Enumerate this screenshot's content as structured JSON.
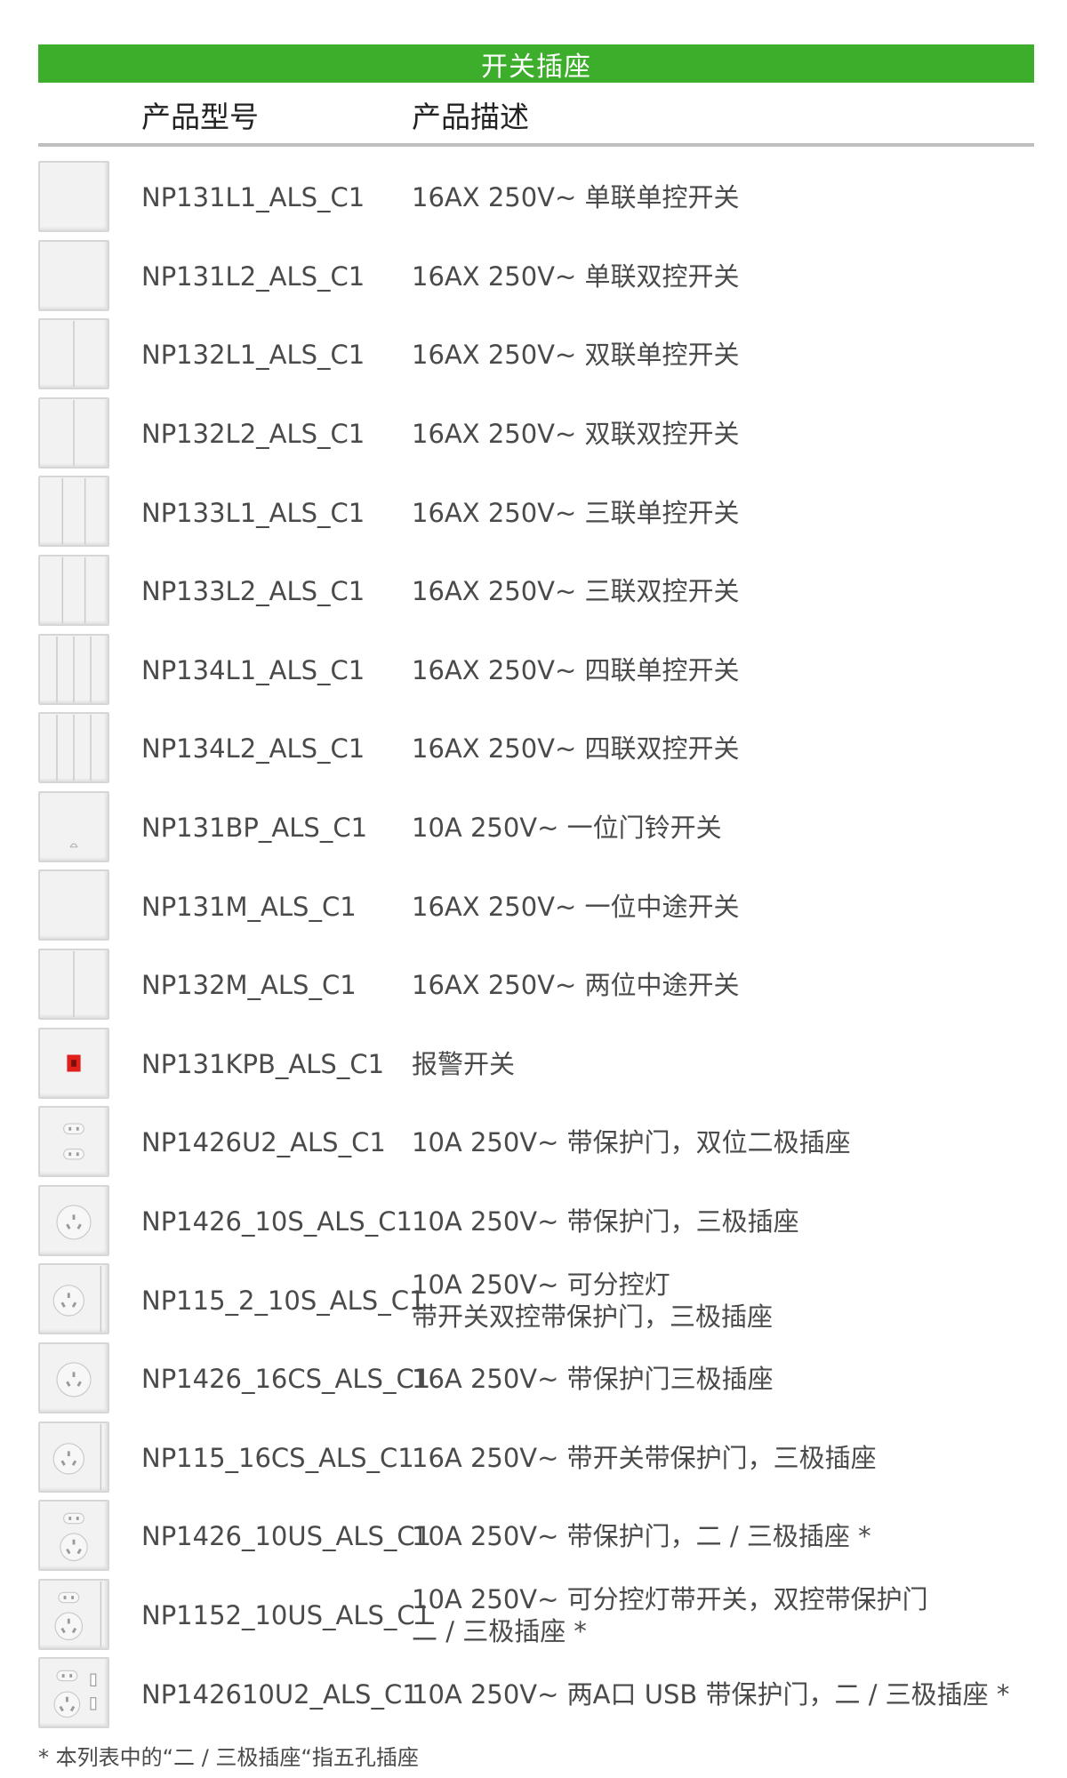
{
  "banner": {
    "title": "开关插座"
  },
  "header": {
    "model_label": "产品型号",
    "desc_label": "产品描述"
  },
  "rows": [
    {
      "model": "NP131L1_ALS_C1",
      "desc": [
        "16AX 250V~ 单联单控开关"
      ],
      "icon": "switch-1gang-icon"
    },
    {
      "model": "NP131L2_ALS_C1",
      "desc": [
        "16AX 250V~ 单联双控开关"
      ],
      "icon": "switch-1gang-icon"
    },
    {
      "model": "NP132L1_ALS_C1",
      "desc": [
        "16AX 250V~ 双联单控开关"
      ],
      "icon": "switch-2gang-icon"
    },
    {
      "model": "NP132L2_ALS_C1",
      "desc": [
        "16AX 250V~ 双联双控开关"
      ],
      "icon": "switch-2gang-icon"
    },
    {
      "model": "NP133L1_ALS_C1",
      "desc": [
        "16AX 250V~ 三联单控开关"
      ],
      "icon": "switch-3gang-icon"
    },
    {
      "model": "NP133L2_ALS_C1",
      "desc": [
        "16AX 250V~ 三联双控开关"
      ],
      "icon": "switch-3gang-icon"
    },
    {
      "model": "NP134L1_ALS_C1",
      "desc": [
        "16AX 250V~ 四联单控开关"
      ],
      "icon": "switch-4gang-icon"
    },
    {
      "model": "NP134L2_ALS_C1",
      "desc": [
        "16AX 250V~ 四联双控开关"
      ],
      "icon": "switch-4gang-icon"
    },
    {
      "model": "NP131BP_ALS_C1",
      "desc": [
        "10A 250V~ 一位门铃开关"
      ],
      "icon": "doorbell-switch-icon"
    },
    {
      "model": "NP131M_ALS_C1",
      "desc": [
        "16AX 250V~ 一位中途开关"
      ],
      "icon": "switch-1gang-icon"
    },
    {
      "model": "NP132M_ALS_C1",
      "desc": [
        "16AX 250V~ 两位中途开关"
      ],
      "icon": "switch-2gang-icon"
    },
    {
      "model": "NP131KPB_ALS_C1",
      "desc": [
        "报警开关"
      ],
      "icon": "alarm-switch-icon"
    },
    {
      "model": "NP1426U2_ALS_C1",
      "desc": [
        "10A 250V~ 带保护门，双位二极插座"
      ],
      "icon": "socket-2pin-double-icon"
    },
    {
      "model": "NP1426_10S_ALS_C1",
      "desc": [
        "10A 250V~ 带保护门，三极插座"
      ],
      "icon": "socket-3pin-icon"
    },
    {
      "model": "NP115_2_10S_ALS_C1",
      "desc": [
        "10A 250V~ 可分控灯",
        "带开关双控带保护门，三极插座"
      ],
      "icon": "socket-3pin-switch-icon"
    },
    {
      "model": "NP1426_16CS_ALS_C1",
      "desc": [
        "16A 250V~ 带保护门三极插座"
      ],
      "icon": "socket-3pin-icon"
    },
    {
      "model": "NP115_16CS_ALS_C1",
      "desc": [
        "16A 250V~ 带开关带保护门，三极插座"
      ],
      "icon": "socket-3pin-switch-icon"
    },
    {
      "model": "NP1426_10US_ALS_C1",
      "desc": [
        "10A 250V~ 带保护门，二 / 三极插座 *"
      ],
      "icon": "socket-5pin-icon"
    },
    {
      "model": "NP1152_10US_ALS_C1",
      "desc": [
        "10A 250V~ 可分控灯带开关，双控带保护门",
        "二 / 三极插座 *"
      ],
      "icon": "socket-5pin-switch-icon"
    },
    {
      "model": "NP142610U2_ALS_C1",
      "desc": [
        "10A 250V~  两A口 USB 带保护门，二 / 三极插座 *"
      ],
      "icon": "socket-5pin-usb-icon"
    }
  ],
  "footnote": "* 本列表中的“二 / 三极插座“指五孔插座",
  "colors": {
    "banner": "#3dae2b",
    "rule": "#bfbfbf",
    "alarm_red": "#e0201b"
  }
}
